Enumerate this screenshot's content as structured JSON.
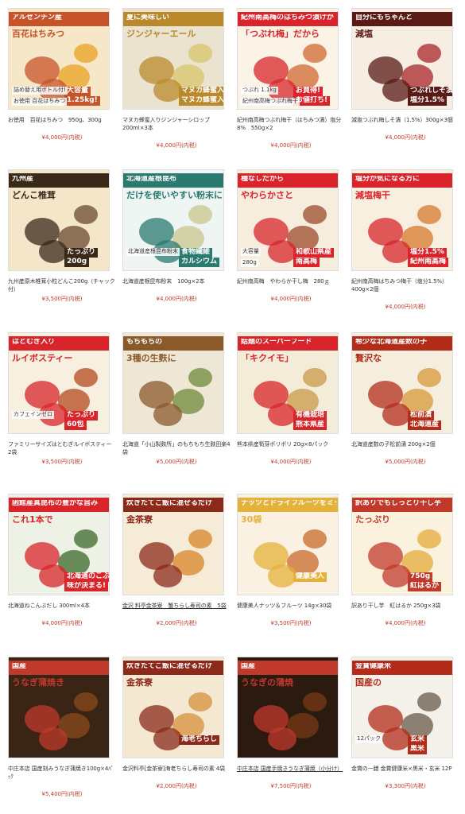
{
  "products": [
    {
      "title": "お徳用　百花はちみつ　950g、300g",
      "price": "¥4,000円(内税)",
      "link": false,
      "labels": [
        "アルゼンチン産",
        "百花はちみつ",
        "大容量",
        "1.25kg!",
        "詰め替え用ボトル付!",
        "お徳用 百花はちみつ"
      ],
      "colors": [
        "#f5e7c8",
        "#e8a320",
        "#c7532a"
      ]
    },
    {
      "title": "マヌカ蜂蜜入りジンジャーシロップ 200ml×3本",
      "price": "¥4,000円(内税)",
      "link": false,
      "labels": [
        "夏に美味しい",
        "ジンジャーエール",
        "マヌカ蜂蜜入り",
        "マヌカ蜂蜜入りジンジャーシロップ"
      ],
      "colors": [
        "#e9e3cf",
        "#d8c46a",
        "#b9892c"
      ]
    },
    {
      "title": "紀州南高梅つぶれ梅干（はちみつ漬）塩分8%　550g×2",
      "price": "¥4,000円(内税)",
      "link": false,
      "labels": [
        "紀州南高梅のはちみつ漬けが",
        "「つぶれ梅」だから",
        "お買得!",
        "お値打ち!",
        "つぶれ 1.1kg",
        "紀州南高梅つぶれ梅干"
      ],
      "colors": [
        "#fbf3e6",
        "#cf6a32",
        "#d8242a"
      ]
    },
    {
      "title": "減塩つぶれ梅しそ漬（1.5%）300g×3個",
      "price": "¥4,000円(内税)",
      "link": false,
      "labels": [
        "自分にもちゃんと",
        "減塩",
        "つぶれしそ漬梅干",
        "塩分1.5%"
      ],
      "colors": [
        "#f6eee2",
        "#a8262a",
        "#5a1a16"
      ]
    },
    {
      "title": "九州産原木椎茸小粒どんこ200g（チャック付）",
      "price": "¥3,500円(内税)",
      "link": false,
      "labels": [
        "九州産",
        "どんこ椎茸",
        "たっぷり",
        "200g"
      ],
      "colors": [
        "#f3e6c9",
        "#6b4a2f",
        "#3a2818"
      ]
    },
    {
      "title": "北海道産根昆布粉末　100g×2本",
      "price": "¥4,000円(内税)",
      "link": false,
      "labels": [
        "北海道産根昆布",
        "だけを使いやすい粉末にしました",
        "食物繊維",
        "カルシウム",
        "北海道産根昆布粉末"
      ],
      "colors": [
        "#eef5f2",
        "#c9c48c",
        "#2a7a6f"
      ]
    },
    {
      "title": "紀州南高梅　やわらか干し梅　280ｇ",
      "price": "¥4,000円(内税)",
      "link": false,
      "labels": [
        "種なしだから",
        "やわらかさと",
        "和歌山県産",
        "南高梅",
        "大容量",
        "280g"
      ],
      "colors": [
        "#f6eddf",
        "#9c4a2b",
        "#d8242a"
      ]
    },
    {
      "title": "紀州南高梅はちみつ梅干（塩分1.5%）400g×2個",
      "price": "¥4,000円(内税)",
      "link": false,
      "labels": [
        "塩分が気になる方に",
        "減塩梅干",
        "塩分1.5%",
        "紀州南高梅"
      ],
      "colors": [
        "#f8efe0",
        "#d6782c",
        "#d8242a"
      ]
    },
    {
      "title": "ファミリーサイズはとむぎルイボスティー 2袋",
      "price": "¥3,500円(内税)",
      "link": false,
      "labels": [
        "はとむぎ入り",
        "ルイボスティー",
        "たっぷり",
        "60包",
        "カフェインゼロ"
      ],
      "colors": [
        "#f7efe0",
        "#b34a1e",
        "#d8242a"
      ]
    },
    {
      "title": "北海道「小山製麩所」のもちもち生麩田楽4袋",
      "price": "¥5,000円(内税)",
      "link": false,
      "labels": [
        "もちもちの",
        "3種の生麩に"
      ],
      "colors": [
        "#efe7d6",
        "#6f8a3a",
        "#8b5a2b"
      ]
    },
    {
      "title": "熊本県産筍芽ポリポリ 20g×8パック",
      "price": "¥4,000円(内税)",
      "link": false,
      "labels": [
        "話題のスーパーフード",
        "「キクイモ」",
        "有機栽培",
        "熊本県産"
      ],
      "colors": [
        "#f3ecd8",
        "#c89a4a",
        "#d8242a"
      ]
    },
    {
      "title": "北海道産数の子松前漬 200g×2個",
      "price": "¥5,000円(内税)",
      "link": false,
      "labels": [
        "希少な北海道産数の子",
        "贅沢な",
        "松前漬",
        "北海道産"
      ],
      "colors": [
        "#f5eedf",
        "#d59a3a",
        "#b32c1a"
      ]
    },
    {
      "title": "北海道ねこんぶだし 300ml×4本",
      "price": "¥4,000円(内税)",
      "link": false,
      "labels": [
        "函館産真昆布の豊かな旨み",
        "これ1本で",
        "北海道のこぶだし",
        "味が決まる!"
      ],
      "colors": [
        "#eef2e6",
        "#3a6a2a",
        "#d8242a"
      ]
    },
    {
      "title": "金沢 料亭金茶寮　蟹ちらし寿司の素　5袋",
      "price": "¥2,000円(内税)",
      "link": true,
      "labels": [
        "炊きたてご飯に混ぜるだけ",
        "金茶寮"
      ],
      "colors": [
        "#f6ebd6",
        "#d8862a",
        "#8b2a1a"
      ]
    },
    {
      "title": "健康美人ナッツ＆フルーツ 14g×30袋",
      "price": "¥3,500円(内税)",
      "link": false,
      "labels": [
        "ナッツとドライフルーツをミックス",
        "30袋",
        "健康美人"
      ],
      "colors": [
        "#fbf1e3",
        "#c96a2a",
        "#e4b23a"
      ]
    },
    {
      "title": "訳あり干し芋　紅はるか 250g×3袋",
      "price": "¥4,000円(内税)",
      "link": false,
      "labels": [
        "訳ありでもしっとり干し芋",
        "たっぷり",
        "750g",
        "紅はるか"
      ],
      "colors": [
        "#fbf2dd",
        "#e4a93a",
        "#c0392b"
      ]
    },
    {
      "title": "中庄本店 国産刻みうなぎ蒲焼き100g×4ﾊﾟｯｸ",
      "price": "¥5,400円(内税)",
      "link": false,
      "labels": [
        "国産",
        "うなぎ蒲焼き"
      ],
      "colors": [
        "#3a2416",
        "#8b4a1e",
        "#c0392b"
      ]
    },
    {
      "title": "金沢料亭[金茶寮]海老ちらし寿司の素 4袋",
      "price": "¥2,000円(内税)",
      "link": false,
      "labels": [
        "炊きたてご飯に混ぜるだけ",
        "金茶寮",
        "海老ちらし"
      ],
      "colors": [
        "#f4e8d2",
        "#d7903a",
        "#8b2a1a"
      ]
    },
    {
      "title": "中庄本店 国産手焼きうなぎ蒲焼（小分け）",
      "price": "¥7,500円(内税)",
      "link": true,
      "labels": [
        "国産",
        "うなぎの蒲焼"
      ],
      "colors": [
        "#2a1a10",
        "#7a3a16",
        "#c0392b"
      ]
    },
    {
      "title": "金賞の一膳 金賞健康米×黒米・玄米 12P",
      "price": "¥3,300円(内税)",
      "link": false,
      "labels": [
        "金賞健康米",
        "国産の",
        "玄米",
        "黒米",
        "12パック"
      ],
      "colors": [
        "#f4f1ea",
        "#6a5a4a",
        "#b32c1a"
      ]
    }
  ]
}
